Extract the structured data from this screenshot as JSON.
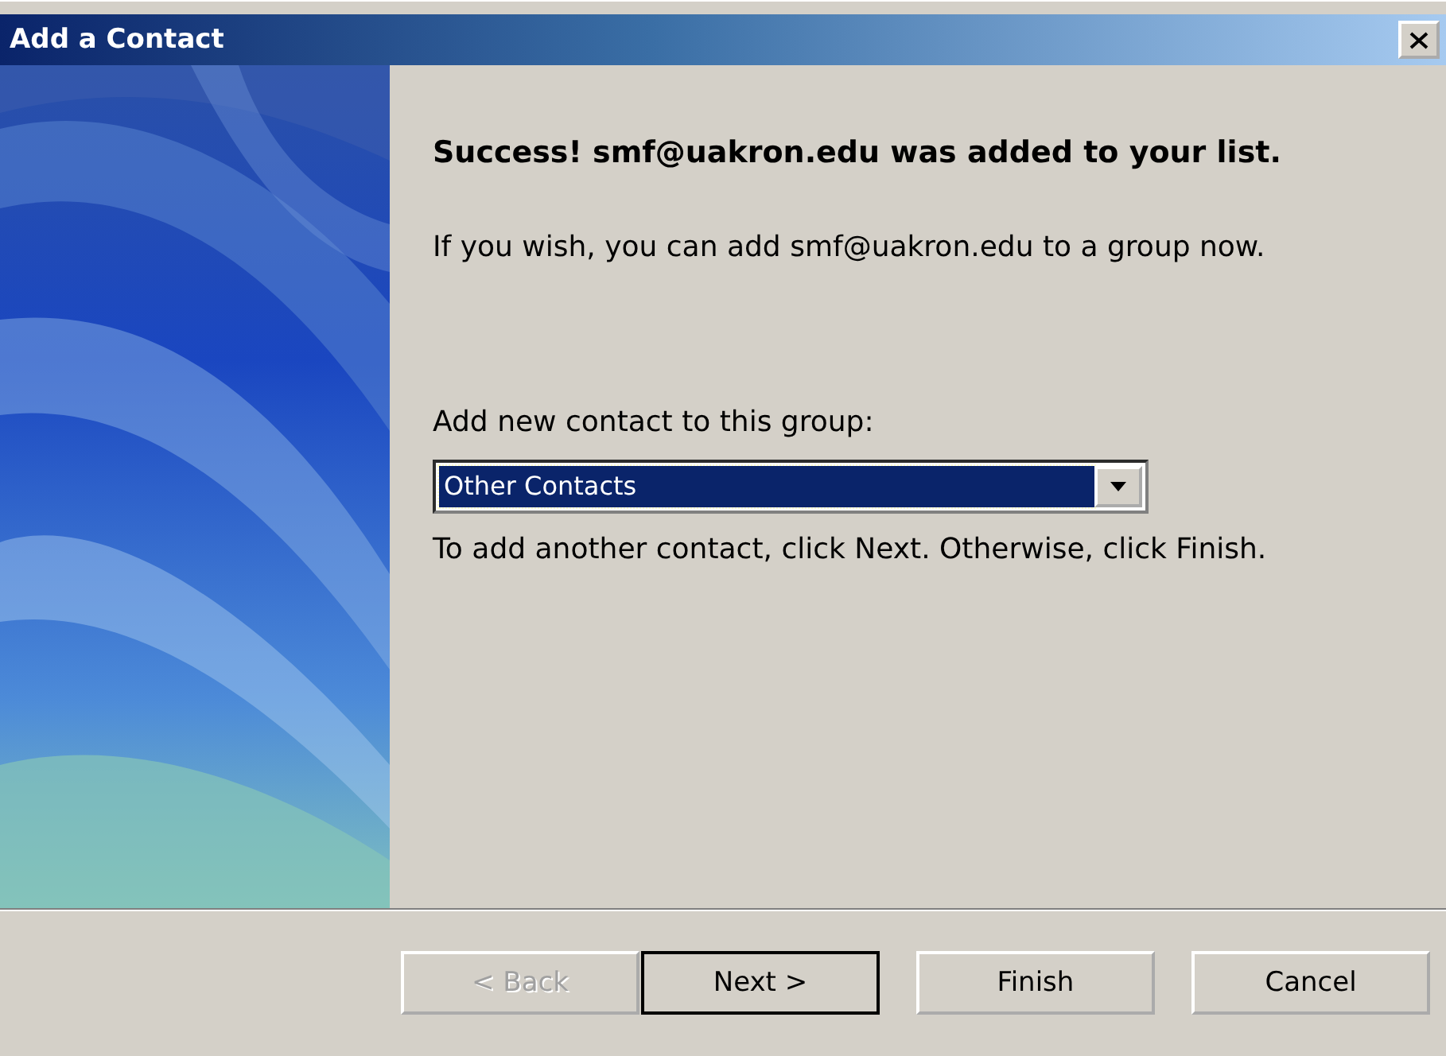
{
  "window": {
    "title": "Add a Contact"
  },
  "heading": "Success! smf@uakron.edu was added to your list.",
  "message": "If you wish, you can add smf@uakron.edu to a group now.",
  "group_label": "Add new contact to this group:",
  "group_select": {
    "value": "Other Contacts",
    "selected": true
  },
  "instruction": "To add another contact, click Next. Otherwise, click Finish.",
  "buttons": [
    {
      "label": "< Back",
      "disabled": true,
      "default": false
    },
    {
      "label": "Next >",
      "disabled": false,
      "default": true
    },
    {
      "label": "Finish",
      "disabled": false,
      "default": false
    },
    {
      "label": "Cancel",
      "disabled": false,
      "default": false
    }
  ]
}
